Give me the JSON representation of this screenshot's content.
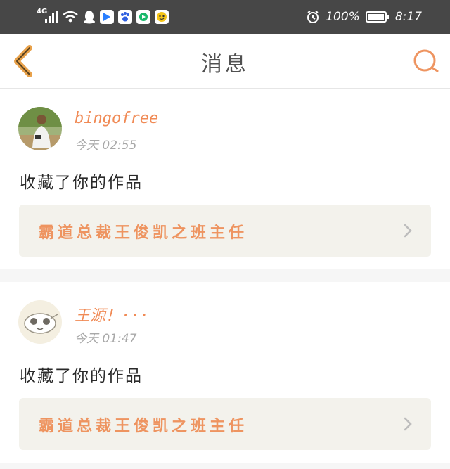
{
  "status_bar": {
    "signal_label": "4G",
    "battery": "100%",
    "time": "8:17",
    "icons": [
      "signal-icon",
      "wifi-icon",
      "qq-icon",
      "app-icon-blue",
      "baidu-icon",
      "app-icon-video",
      "app-icon-yellow",
      "alarm-icon",
      "battery-icon"
    ]
  },
  "header": {
    "title": "消息",
    "icons": [
      "back-icon",
      "search-icon"
    ],
    "accent_color": "#e8a14a"
  },
  "messages": [
    {
      "username": "bingofree",
      "time": "今天 02:55",
      "action": "收藏了你的作品",
      "work_title": "霸道总裁王俊凯之班主任"
    },
    {
      "username": "王源！···",
      "time": "今天 01:47",
      "action": "收藏了你的作品",
      "work_title": "霸道总裁王俊凯之班主任"
    }
  ],
  "colors": {
    "username": "#f08a55",
    "work_title": "#ee9460",
    "work_box_bg": "#f3f2ec",
    "status_bar_bg": "#474747"
  }
}
